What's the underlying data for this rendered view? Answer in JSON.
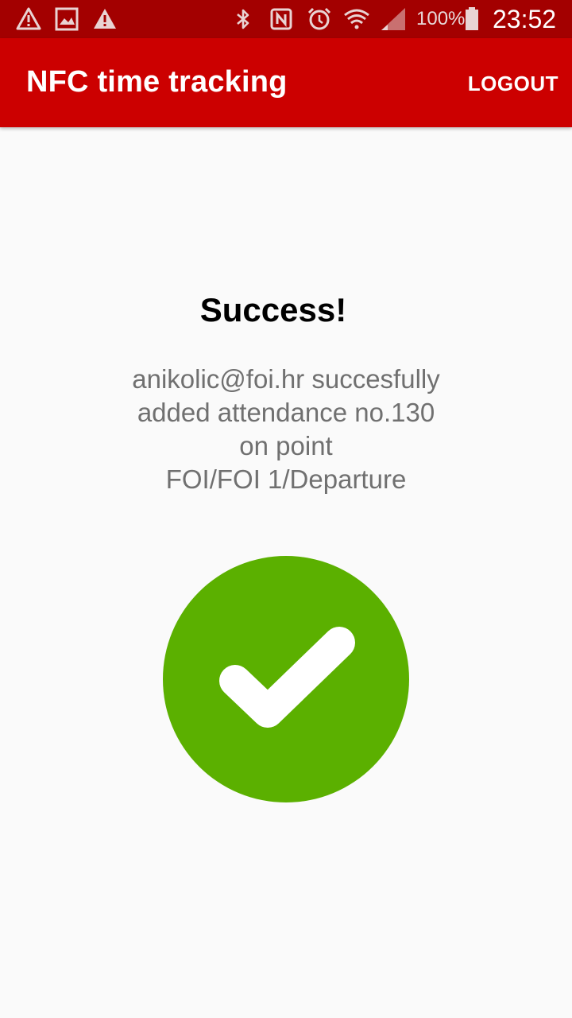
{
  "status_bar": {
    "icons_left": [
      "warning-icon",
      "image-icon",
      "warning-icon"
    ],
    "icons_right": [
      "bluetooth-icon",
      "nfc-icon",
      "alarm-icon",
      "wifi-icon",
      "signal-icon",
      "battery-icon"
    ],
    "battery": "100%",
    "time": "23:52",
    "color": "#a30000"
  },
  "app_bar": {
    "title": "NFC time tracking",
    "logout_label": "LOGOUT",
    "color": "#cc0000"
  },
  "main": {
    "title": "Success!",
    "message_lines": [
      "anikolic@foi.hr succesfully",
      "added attendance no.130",
      "on point",
      "FOI/FOI 1/Departure"
    ],
    "status_icon": "check-circle-icon",
    "success_color": "#5bb000"
  }
}
